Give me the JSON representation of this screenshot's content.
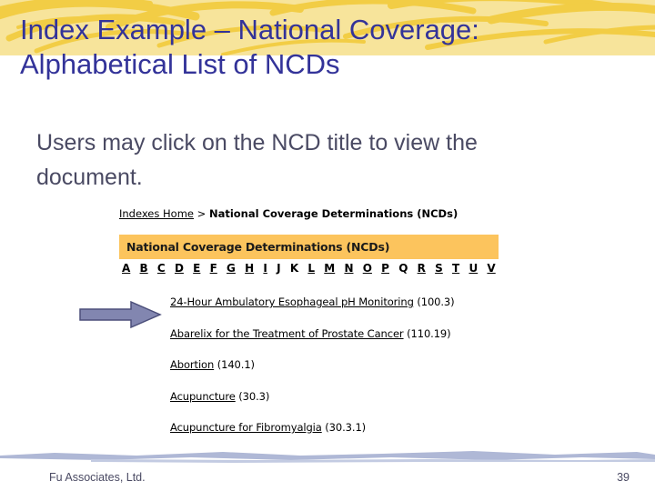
{
  "slide": {
    "title_line1": "Index Example – National Coverage:",
    "title_line2": "Alphabetical List of NCDs",
    "body_text": "Users may click on the NCD title to view the document."
  },
  "colors": {
    "banner_bg": "#F7E49B",
    "banner_swirl": "#F5D14A",
    "title_text": "#333399",
    "body_text": "#4A4A63",
    "orange_bar": "#FCC45D",
    "arrow_fill": "#8286B0",
    "arrow_stroke": "#4C4F7A",
    "footer_rule": "#AFB8D6"
  },
  "webcap": {
    "breadcrumb": {
      "home_link": "Indexes Home",
      "separator": " > ",
      "current": "National Coverage Determinations (NCDs)"
    },
    "header_bar_label": "National Coverage Determinations (NCDs)",
    "alphabet": [
      {
        "letter": "A",
        "is_link": true
      },
      {
        "letter": "B",
        "is_link": true
      },
      {
        "letter": "C",
        "is_link": true
      },
      {
        "letter": "D",
        "is_link": true
      },
      {
        "letter": "E",
        "is_link": true
      },
      {
        "letter": "F",
        "is_link": true
      },
      {
        "letter": "G",
        "is_link": true
      },
      {
        "letter": "H",
        "is_link": true
      },
      {
        "letter": "I",
        "is_link": true
      },
      {
        "letter": "J",
        "is_link": false
      },
      {
        "letter": "K",
        "is_link": false
      },
      {
        "letter": "L",
        "is_link": true
      },
      {
        "letter": "M",
        "is_link": true
      },
      {
        "letter": "N",
        "is_link": true
      },
      {
        "letter": "O",
        "is_link": true
      },
      {
        "letter": "P",
        "is_link": true
      },
      {
        "letter": "Q",
        "is_link": false
      },
      {
        "letter": "R",
        "is_link": true
      },
      {
        "letter": "S",
        "is_link": true
      },
      {
        "letter": "T",
        "is_link": true
      },
      {
        "letter": "U",
        "is_link": true
      },
      {
        "letter": "V",
        "is_link": true
      }
    ],
    "ncd_items": [
      {
        "title": "24-Hour Ambulatory Esophageal pH Monitoring",
        "id": " (100.3)"
      },
      {
        "title": "Abarelix for the Treatment of Prostate Cancer",
        "id": " (110.19)"
      },
      {
        "title": "Abortion",
        "id": " (140.1)"
      },
      {
        "title": "Acupuncture",
        "id": " (30.3)"
      },
      {
        "title": "Acupuncture for Fibromyalgia",
        "id": " (30.3.1)"
      }
    ]
  },
  "footer": {
    "company": "Fu Associates, Ltd.",
    "page_number": "39"
  }
}
